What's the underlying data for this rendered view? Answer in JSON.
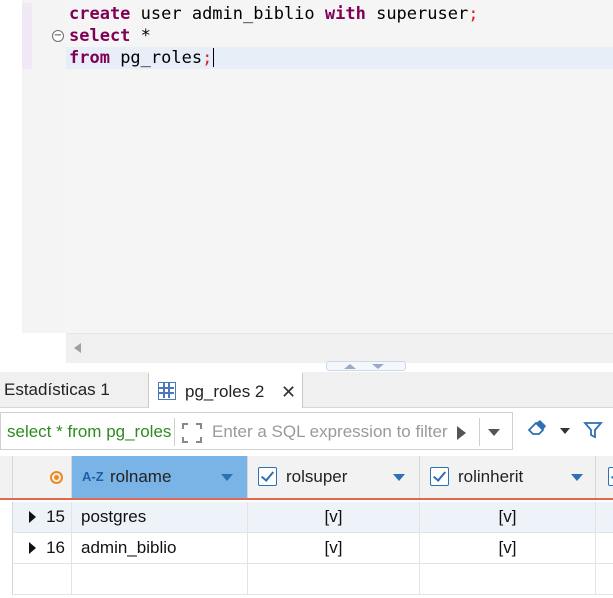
{
  "editor": {
    "lines": [
      {
        "kw1": "create",
        "rest": " user admin_biblio ",
        "kw2": "with",
        "rest2": " superuser",
        "punct": ";"
      },
      {
        "kw1": "select",
        "rest": " *"
      },
      {
        "kw1": "from",
        "rest": " pg_roles",
        "punct": ";"
      }
    ],
    "fold_symbol": "−"
  },
  "tabs": {
    "stats_label": "Estadísticas 1",
    "active_label": "pg_roles 2",
    "close_symbol": "✕"
  },
  "filter": {
    "value": "select * from pg_roles",
    "placeholder": "Enter a SQL expression to filter results"
  },
  "grid": {
    "columns": [
      {
        "name": "rolname",
        "type_icon": "A-Z"
      },
      {
        "name": "rolsuper",
        "type_icon": "checkbox"
      },
      {
        "name": "rolinherit",
        "type_icon": "checkbox"
      }
    ],
    "rows": [
      {
        "num": "15",
        "rolname": "postgres",
        "rolsuper": "[v]",
        "rolinherit": "[v]"
      },
      {
        "num": "16",
        "rolname": "admin_biblio",
        "rolsuper": "[v]",
        "rolinherit": "[v]"
      }
    ]
  },
  "colors": {
    "keyword": "#7f0055",
    "accent_blue": "#2e6fb5",
    "header_selected": "#7ab3e6",
    "filter_text": "#2e8b20",
    "header_underline": "#e06a4e",
    "orange": "#f08a1e"
  }
}
